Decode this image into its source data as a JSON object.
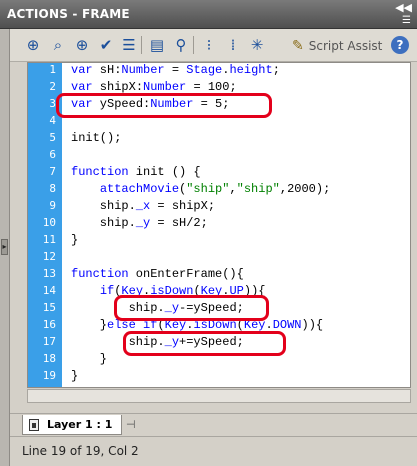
{
  "panel": {
    "title": "ACTIONS - FRAME"
  },
  "toolbar": {
    "script_assist_label": "Script Assist"
  },
  "code": {
    "line_numbers": [
      "1",
      "2",
      "3",
      "4",
      "5",
      "6",
      "7",
      "8",
      "9",
      "10",
      "11",
      "12",
      "13",
      "14",
      "15",
      "16",
      "17",
      "18",
      "19"
    ],
    "lines": [
      "var sH:Number = Stage.height;",
      "var shipX:Number = 100;",
      "var ySpeed:Number = 5;",
      "",
      "init();",
      "",
      "function init () {",
      "    attachMovie(\"ship\",\"ship\",2000);",
      "    ship._x = shipX;",
      "    ship._y = sH/2;",
      "}",
      "",
      "function onEnterFrame(){",
      "    if(Key.isDown(Key.UP)){",
      "        ship._y-=ySpeed;",
      "    }else if(Key.isDown(Key.DOWN)){",
      "        ship._y+=ySpeed;",
      "    }",
      "}"
    ]
  },
  "tabs": {
    "layer_label": "Layer 1 : 1"
  },
  "status": {
    "text": "Line 19 of 19, Col 2"
  },
  "colors": {
    "gutter": "#3a9fe8",
    "highlight": "#e3001b",
    "keyword": "#0000ff",
    "string": "#008000"
  }
}
